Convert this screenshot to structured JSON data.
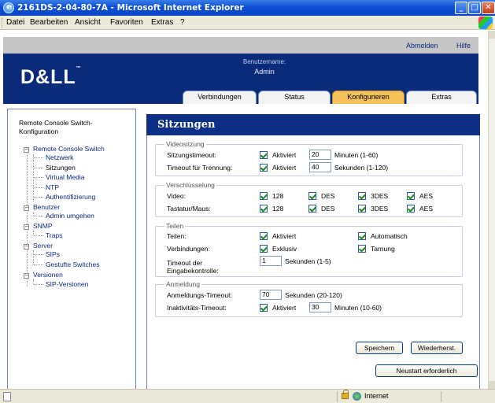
{
  "window": {
    "title": "2161DS-2-04-80-7A - Microsoft Internet Explorer"
  },
  "menubar": {
    "items": [
      "Datei",
      "Bearbeiten",
      "Ansicht",
      "Favoriten",
      "Extras",
      "?"
    ]
  },
  "header": {
    "logo": "D&LL",
    "logo_tm": "™",
    "username_label": "Benutzername:",
    "username": "Admin",
    "logout": "Abmelden",
    "help": "Hilfe"
  },
  "tabs": [
    {
      "label": "Verbindungen",
      "active": false
    },
    {
      "label": "Status",
      "active": false
    },
    {
      "label": "Konfigurieren",
      "active": true
    },
    {
      "label": "Extras",
      "active": false
    }
  ],
  "nav": {
    "title": "Remote Console Switch-Konfiguration",
    "items": [
      {
        "label": "Remote Console Switch",
        "level": 0
      },
      {
        "label": "Netzwerk",
        "level": 1
      },
      {
        "label": "Sitzungen",
        "level": 1
      },
      {
        "label": "Virtual Media",
        "level": 1
      },
      {
        "label": "NTP",
        "level": 1
      },
      {
        "label": "Authentifizierung",
        "level": 1
      },
      {
        "label": "Benutzer",
        "level": 0
      },
      {
        "label": "Admin umgehen",
        "level": 1
      },
      {
        "label": "SNMP",
        "level": 0
      },
      {
        "label": "Traps",
        "level": 1
      },
      {
        "label": "Server",
        "level": 0
      },
      {
        "label": "SIPs",
        "level": 1
      },
      {
        "label": "Gestufte Switches",
        "level": 1
      },
      {
        "label": "Versionen",
        "level": 0
      },
      {
        "label": "SIP-Versionen",
        "level": 1
      }
    ]
  },
  "main": {
    "title": "Sitzungen",
    "video": {
      "legend": "Videositzung",
      "session_timeout_label": "Sitzungstimeout:",
      "session_timeout_enabled": true,
      "enabled_label": "Aktiviert",
      "session_timeout_value": "20",
      "session_timeout_unit": "Minuten (1-60)",
      "disconnect_timeout_label": "Timeout für Trennung:",
      "disconnect_timeout_enabled": true,
      "disconnect_timeout_value": "40",
      "disconnect_timeout_unit": "Sekunden (1-120)"
    },
    "encryption": {
      "legend": "Verschlüsselung",
      "video_label": "Video:",
      "keyboard_label": "Tastatur/Maus:",
      "options": [
        "128",
        "DES",
        "3DES",
        "AES"
      ]
    },
    "sharing": {
      "legend": "Teilen",
      "share_label": "Teilen:",
      "enabled_label": "Aktiviert",
      "automatic_label": "Automatisch",
      "connections_label": "Verbindungen:",
      "exclusive_label": "Exklusiv",
      "stealth_label": "Tarnung",
      "input_timeout_label_1": "Timeout der",
      "input_timeout_label_2": "Eingabekontrolle:",
      "input_timeout_value": "1",
      "input_timeout_unit": "Sekunden (1-5)"
    },
    "login": {
      "legend": "Anmeldung",
      "login_timeout_label": "Anmeldungs-Timeout:",
      "login_timeout_value": "70",
      "login_timeout_unit": "Sekunden (20-120)",
      "inactivity_label": "Inaktivitäts-Timeout:",
      "inactivity_enabled_label": "Aktiviert",
      "inactivity_value": "30",
      "inactivity_unit": "Minuten (10-60)"
    },
    "save_button": "Speichern",
    "restore_button": "Wiederherst.",
    "restart_button": "Neustart erforderlich"
  },
  "statusbar": {
    "zone": "Internet"
  }
}
